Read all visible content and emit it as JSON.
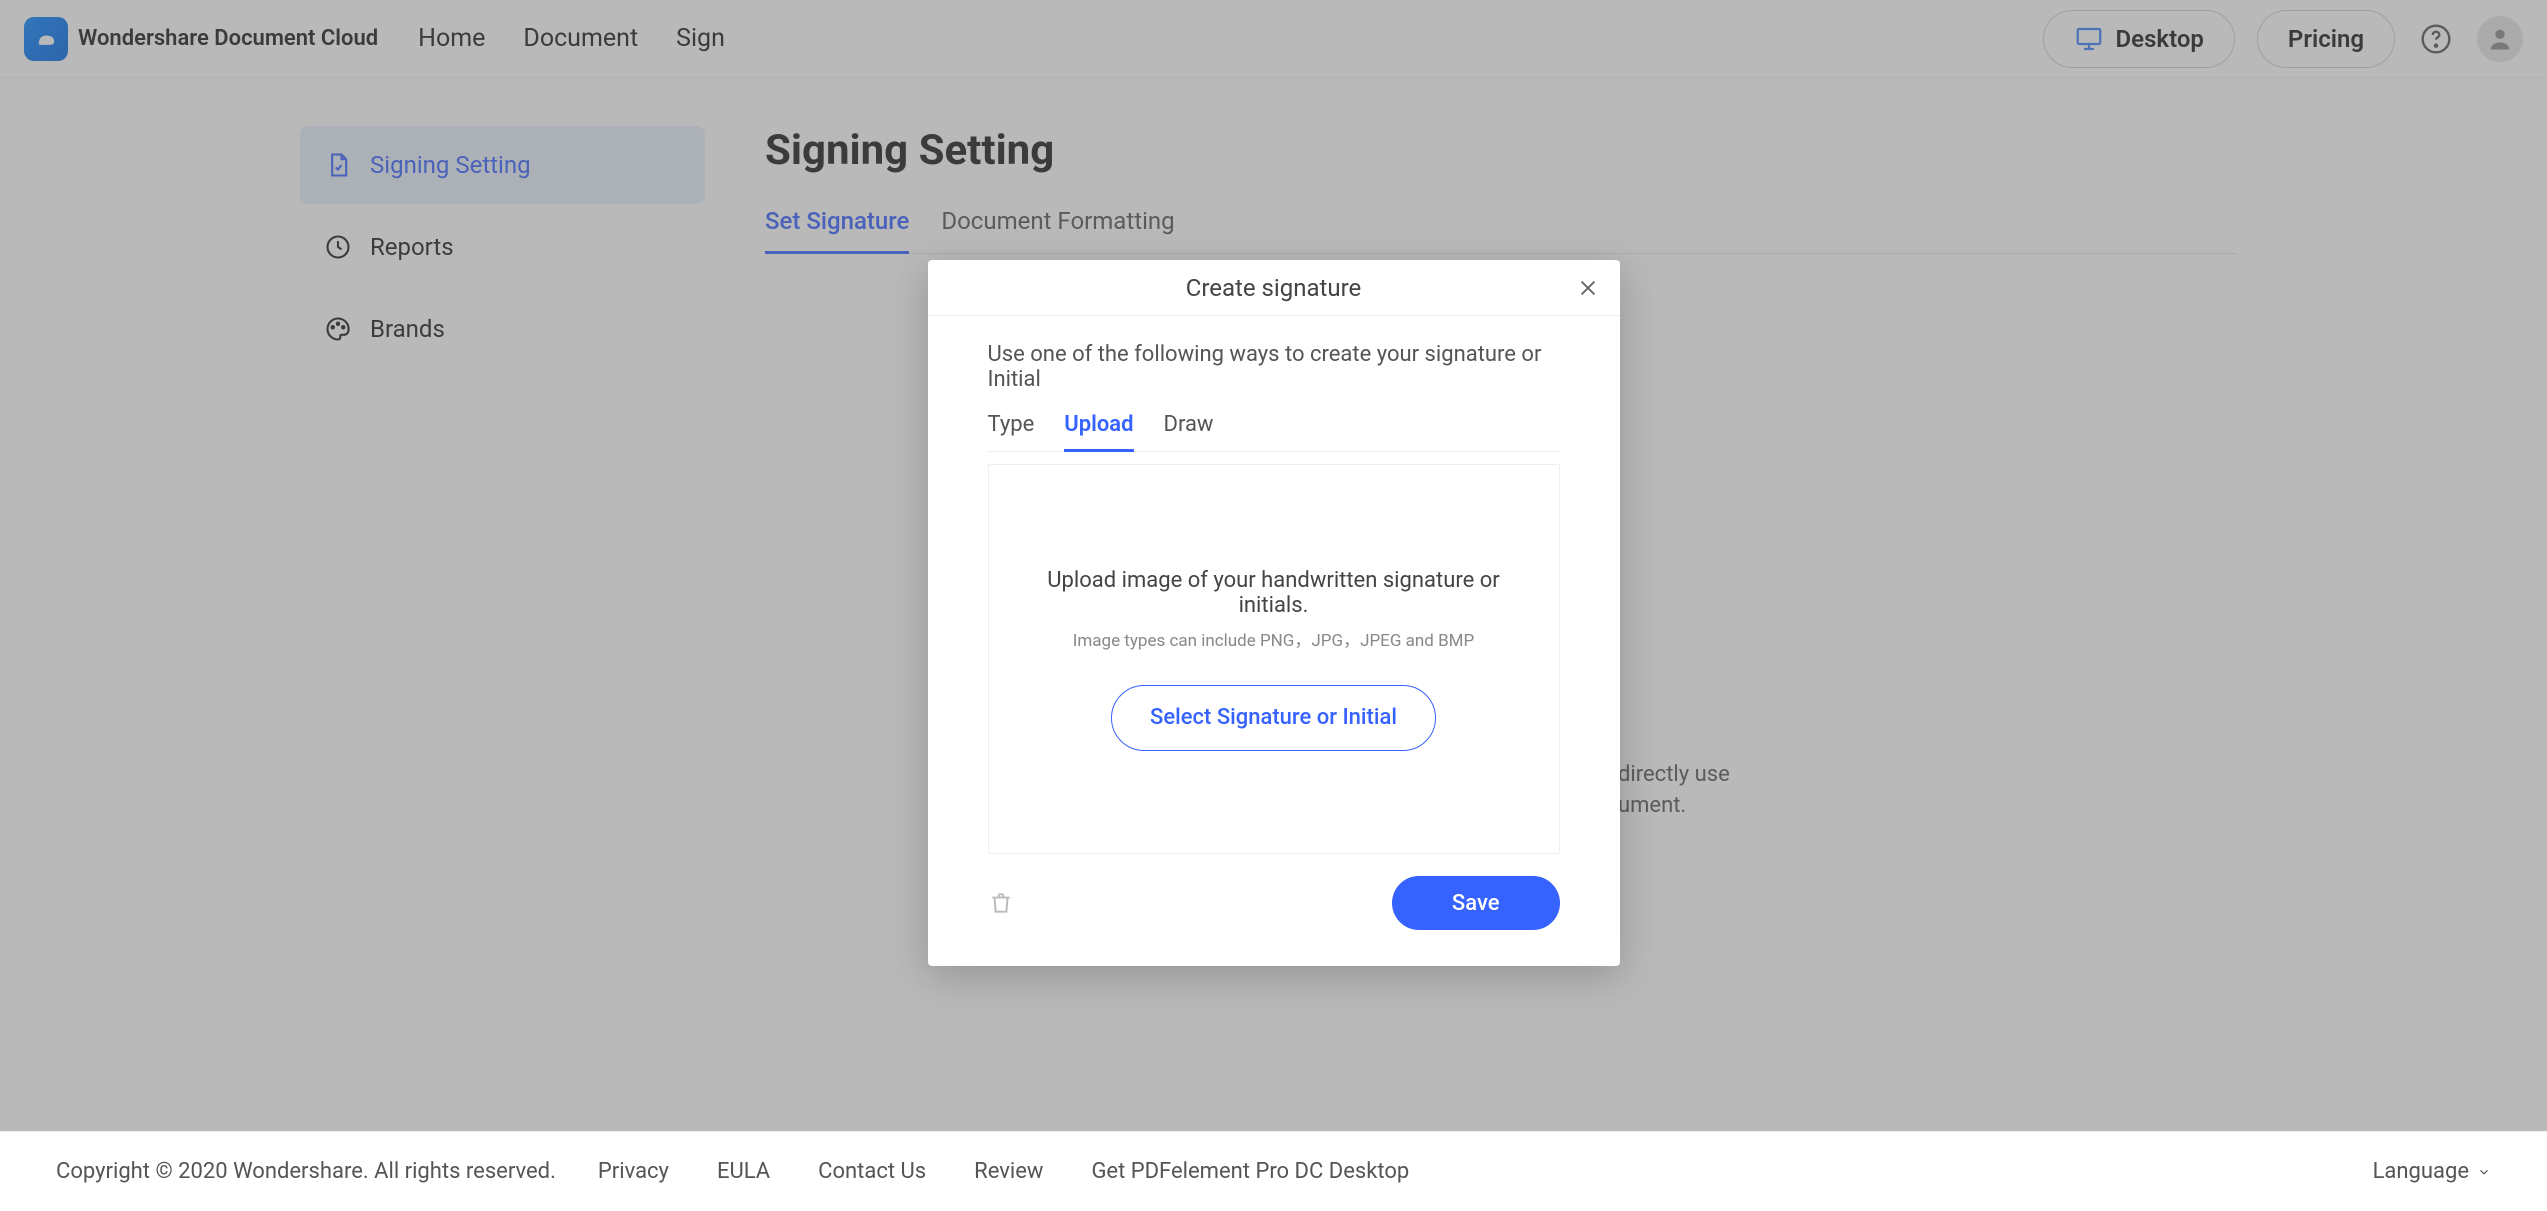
{
  "header": {
    "logo_text": "Wondershare Document Cloud",
    "nav": [
      "Home",
      "Document",
      "Sign"
    ],
    "desktop_label": "Desktop",
    "pricing_label": "Pricing"
  },
  "sidebar": {
    "items": [
      {
        "label": "Signing Setting",
        "icon": "document-sign-icon"
      },
      {
        "label": "Reports",
        "icon": "clock-icon"
      },
      {
        "label": "Brands",
        "icon": "palette-icon"
      }
    ]
  },
  "main": {
    "title": "Signing Setting",
    "tabs": [
      "Set Signature",
      "Document Formatting"
    ],
    "bg_hint_line1": "directly use",
    "bg_hint_line2": "ument."
  },
  "modal": {
    "title": "Create signature",
    "subtitle": "Use one of the following ways to create your signature or Initial",
    "tabs": [
      "Type",
      "Upload",
      "Draw"
    ],
    "upload_text1": "Upload image of your handwritten signature or initials.",
    "upload_text2": "Image types can include PNG，JPG，JPEG and BMP",
    "select_button": "Select Signature or Initial",
    "save_button": "Save"
  },
  "footer": {
    "copyright": "Copyright © 2020 Wondershare. All rights reserved.",
    "links": [
      "Privacy",
      "EULA",
      "Contact Us",
      "Review",
      "Get PDFelement Pro DC Desktop"
    ],
    "language_label": "Language"
  },
  "colors": {
    "accent": "#3662ff"
  }
}
